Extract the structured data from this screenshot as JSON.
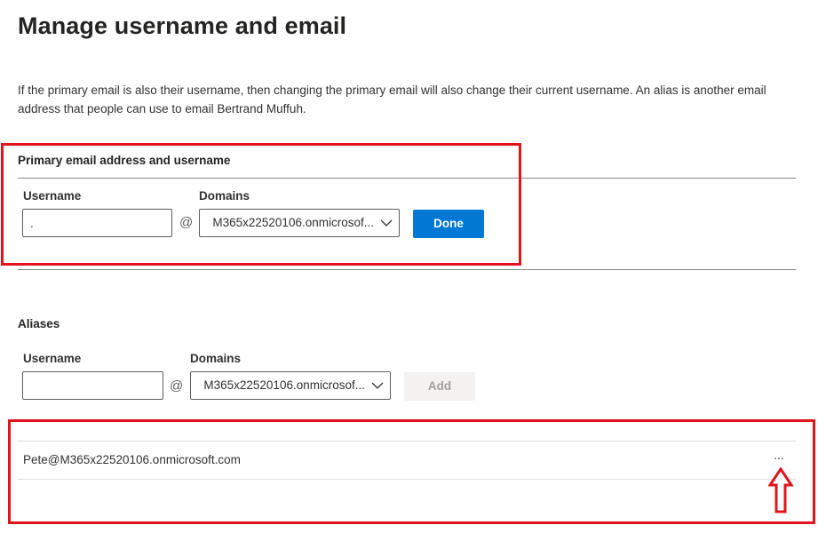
{
  "page": {
    "title": "Manage username and email",
    "description": "If the primary email is also their username, then changing the primary email will also change their current username. An alias is another email address that people can use to email Bertrand Muffuh."
  },
  "primary": {
    "section_title": "Primary email address and username",
    "username_label": "Username",
    "username_value": ".",
    "at": "@",
    "domains_label": "Domains",
    "domain_value": "M365x22520106.onmicrosof...",
    "done_label": "Done"
  },
  "aliases": {
    "section_title": "Aliases",
    "username_label": "Username",
    "username_value": "",
    "at": "@",
    "domains_label": "Domains",
    "domain_value": "M365x22520106.onmicrosof...",
    "add_label": "Add",
    "list": [
      {
        "address": "Pete@M365x22520106.onmicrosoft.com",
        "more_label": "..."
      }
    ]
  },
  "annotations": {
    "highlight_color": "#e0151b",
    "arrow_icon": "up-arrow-icon"
  },
  "colors": {
    "accent": "#0078d4",
    "disabled_bg": "#f3f2f1",
    "disabled_text": "#a19f9d"
  }
}
